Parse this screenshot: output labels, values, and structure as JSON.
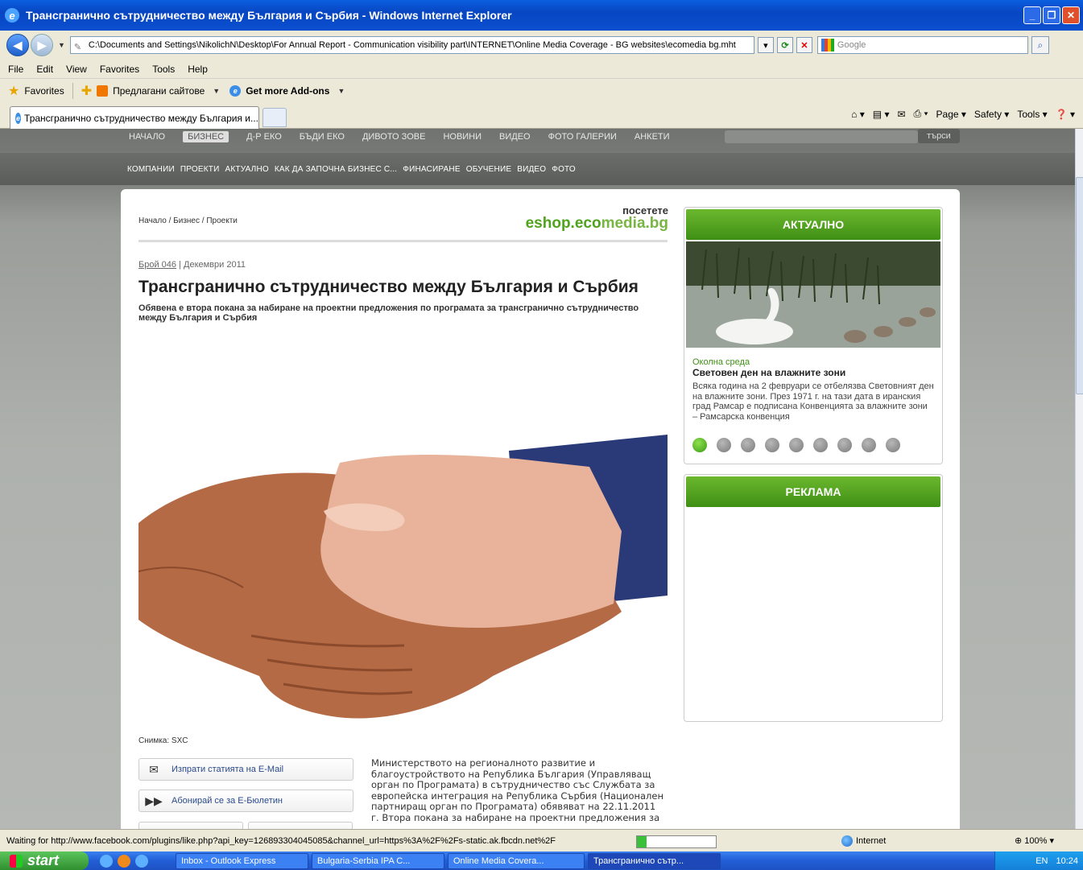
{
  "window": {
    "title": "Трансгранично сътрудничество между България и Сърбия - Windows Internet Explorer"
  },
  "address_bar": {
    "url": "C:\\Documents and Settings\\NikolichN\\Desktop\\For Annual Report - Communication visibility part\\INTERNET\\Online Media Coverage - BG websites\\ecomedia bg.mht",
    "search_placeholder": "Google"
  },
  "menu": [
    "File",
    "Edit",
    "View",
    "Favorites",
    "Tools",
    "Help"
  ],
  "favorites_bar": {
    "favorites": "Favorites",
    "suggested": "Предлагани сайтове",
    "addons": "Get more Add-ons"
  },
  "tab": {
    "title": "Трансгранично сътрудничество между България и..."
  },
  "command_bar": [
    "Page",
    "Safety",
    "Tools"
  ],
  "site": {
    "top_nav": [
      "НАЧАЛО",
      "БИЗНЕС",
      "Д-Р ЕКО",
      "БЪДИ ЕКО",
      "ДИВОТО ЗОВЕ",
      "НОВИНИ",
      "ВИДЕО",
      "ФОТО ГАЛЕРИИ",
      "АНКЕТИ"
    ],
    "search_button": "търси",
    "sub_nav": [
      "КОМПАНИИ",
      "ПРОЕКТИ",
      "АКТУАЛНО",
      "КАК ДА ЗАПОЧНА БИЗНЕС С...",
      "ФИНАСИРАНЕ",
      "ОБУЧЕНИЕ",
      "ВИДЕО",
      "ФОТО"
    ],
    "breadcrumb": "Начало / Бизнес / Проекти",
    "eshop_visit": "посетете",
    "eshop_brand_a": "eshop.eco",
    "eshop_brand_b": "media.bg",
    "issue_link": "Брой 046",
    "issue_sep": " | ",
    "issue_date": "Декември 2011",
    "title": "Трансгранично сътрудничество между България и Сърбия",
    "subtitle": "Обявена е втора покана за набиране на проектни предложения по програмата за трансгранично сътрудничество между България и Сърбия",
    "photo_caption": "Снимка: SXC",
    "email_button": "Изпрати статията на E-Mail",
    "subscribe_button": "Абонирай се за Е-Бюлетин",
    "body": "Министерството на регионалното развитие и благоустройството на Република България (Управляващ орган по Програмата) в сътрудничество със Службата за европейска интеграция на Република Сърбия (Национален партниращ орган по Програмата) обявяват на 22.11.2011 г. Втора покана за набиране на проектни предложения за",
    "aktualno": {
      "heading": "АКТУАЛНО",
      "category": "Околна среда",
      "headline": "Световен ден на влажните зони",
      "text": "Всяка година на 2 февруари се отбелязва Световният ден на влажните зони. През 1971 г. на тази дата в иранския град Рамсар е подписана Конвенцията за влажните зони – Рамсарска конвенция",
      "slides": 9,
      "active_slide": 1
    },
    "reklama": {
      "heading": "РЕКЛАМА"
    }
  },
  "status_bar": {
    "message": "Waiting for http://www.facebook.com/plugins/like.php?api_key=126893304045085&channel_url=https%3A%2F%2Fs-static.ak.fbcdn.net%2F",
    "progress": 0.12,
    "zone": "Internet",
    "zoom": "100%"
  },
  "taskbar": {
    "start": "start",
    "tasks": [
      "Inbox - Outlook Express",
      "Bulgaria-Serbia IPA C...",
      "Online Media Covera...",
      "Трансгранично сътр..."
    ],
    "lang": "EN",
    "time": "10:24"
  }
}
